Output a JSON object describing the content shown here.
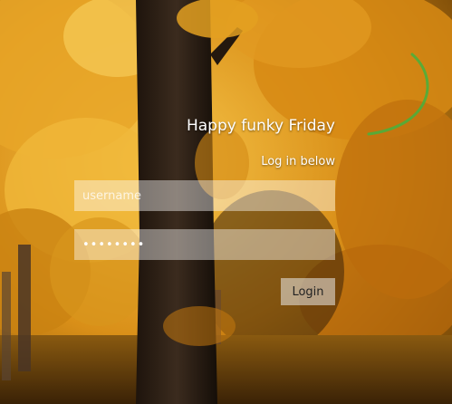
{
  "greeting": "Happy funky Friday",
  "subtitle": "Log in below",
  "username": {
    "placeholder": "username",
    "value": ""
  },
  "password": {
    "value": "password"
  },
  "login_button": "Login",
  "colors": {
    "spinner_arc": "#4caf3c",
    "field_bg": "rgba(255,255,255,0.42)",
    "button_bg": "rgba(235,235,235,0.55)"
  },
  "icons": {
    "loading": "loading-arc-icon"
  }
}
